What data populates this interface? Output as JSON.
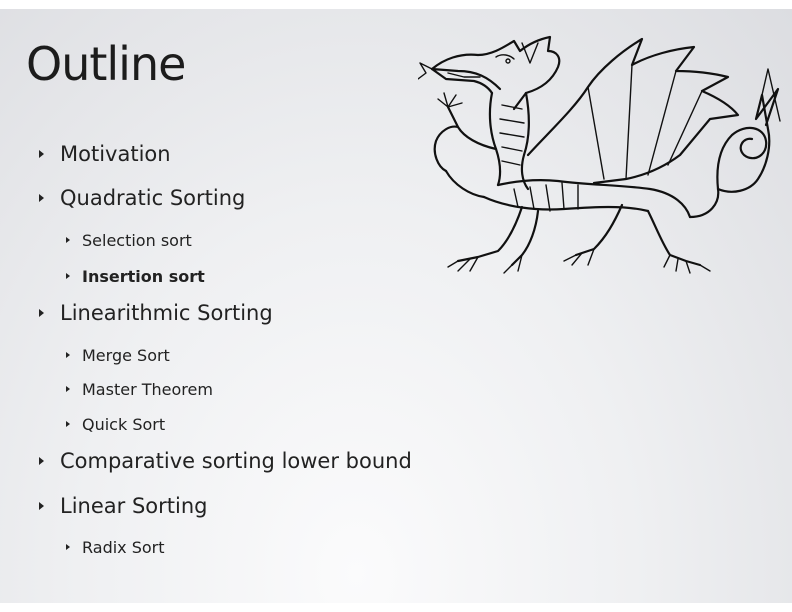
{
  "slide": {
    "title": "Outline",
    "bullets": [
      {
        "label": "Motivation"
      },
      {
        "label": "Quadratic Sorting"
      },
      {
        "label": "Selection sort"
      },
      {
        "label": "Insertion sort"
      },
      {
        "label": "Linearithmic Sorting"
      },
      {
        "label": "Merge Sort"
      },
      {
        "label": "Master Theorem"
      },
      {
        "label": "Quick Sort"
      },
      {
        "label": "Comparative sorting lower bound"
      },
      {
        "label": "Linear Sorting"
      },
      {
        "label": "Radix Sort"
      }
    ],
    "image": "welsh-dragon-icon"
  }
}
